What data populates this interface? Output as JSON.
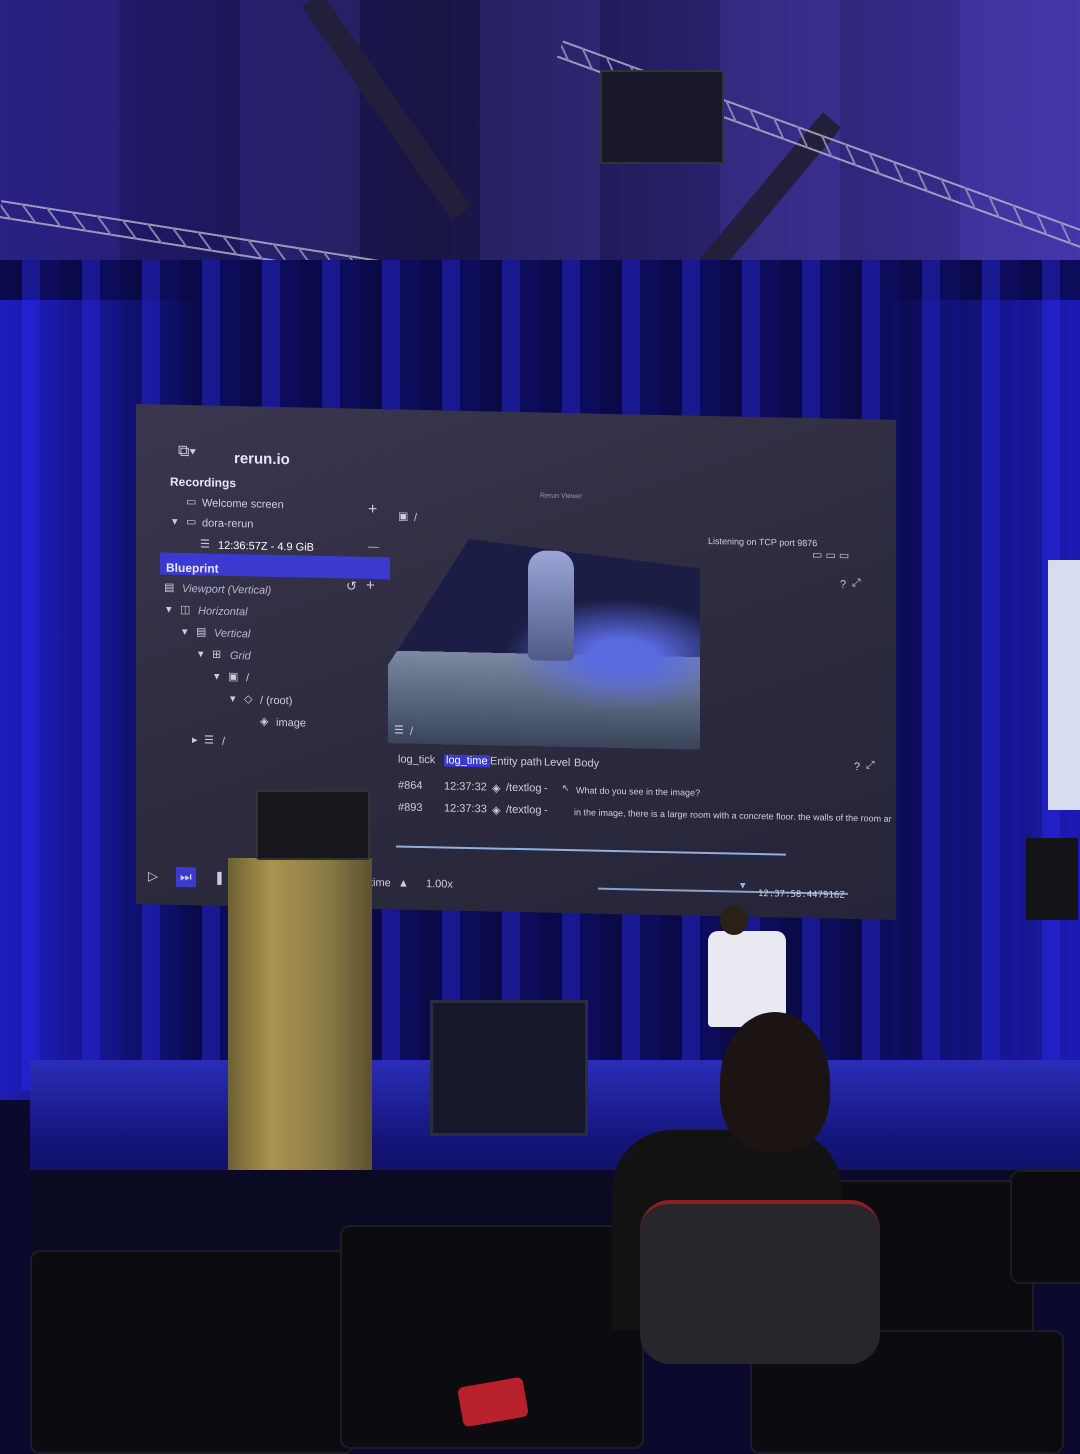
{
  "app": {
    "brand": "rerun.io",
    "window_title": "Rerun Viewer"
  },
  "recordings": {
    "header": "Recordings",
    "add_label": "+",
    "items": [
      {
        "label": "Welcome screen",
        "icon": "window-icon"
      },
      {
        "label": "dora-rerun",
        "icon": "window-icon"
      },
      {
        "label": "12:36:57Z - 4.9 GiB",
        "icon": "database-icon"
      }
    ]
  },
  "blueprint": {
    "header": "Blueprint",
    "tree": [
      {
        "label": "Viewport (Vertical)",
        "icon": "viewport-icon"
      },
      {
        "label": "Horizontal",
        "icon": "horizontal-split-icon"
      },
      {
        "label": "Vertical",
        "icon": "vertical-split-icon"
      },
      {
        "label": "Grid",
        "icon": "grid-icon"
      },
      {
        "label": "/",
        "icon": "space-view-icon"
      },
      {
        "label": "/ (root)",
        "icon": "entity-icon"
      },
      {
        "label": "image",
        "icon": "entity-icon"
      },
      {
        "label": "/",
        "icon": "textlog-icon"
      }
    ]
  },
  "viewer": {
    "space_path": "/",
    "status": "Listening on TCP port 9876",
    "textlog_path": "/"
  },
  "textlog": {
    "columns": [
      "log_tick",
      "log_time",
      "Entity path",
      "Level",
      "Body"
    ],
    "rows": [
      {
        "tick": "#864",
        "time": "12:37:32",
        "entity": "/textlog",
        "level": "-",
        "body": "What do you see in the image?"
      },
      {
        "tick": "#893",
        "time": "12:37:33",
        "entity": "/textlog",
        "level": "-",
        "body": "in the image, there is a large room with a concrete floor. the walls of the room ar"
      }
    ]
  },
  "timebar": {
    "timeline_name": "time",
    "speed": "1.00x",
    "current_time": "12:37:58.447916Z"
  },
  "colors": {
    "accent": "#3a3ad0",
    "stage_light": "#2a2db8"
  }
}
